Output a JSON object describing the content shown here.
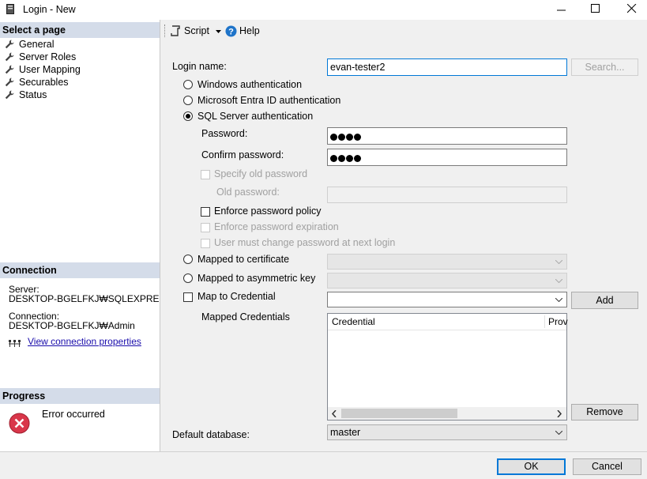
{
  "window": {
    "title": "Login - New",
    "app_icon": "server-icon"
  },
  "left": {
    "select_page_header": "Select a page",
    "pages": [
      {
        "label": "General",
        "icon": "wrench-icon"
      },
      {
        "label": "Server Roles",
        "icon": "wrench-icon"
      },
      {
        "label": "User Mapping",
        "icon": "wrench-icon"
      },
      {
        "label": "Securables",
        "icon": "wrench-icon"
      },
      {
        "label": "Status",
        "icon": "wrench-icon"
      }
    ],
    "connection_header": "Connection",
    "server_label": "Server:",
    "server_value": "DESKTOP-BGELFKJ₩SQLEXPRE",
    "connection_label": "Connection:",
    "connection_value": "DESKTOP-BGELFKJ₩Admin",
    "view_connection_properties": "View connection properties",
    "progress_header": "Progress",
    "progress_status": "Error occurred"
  },
  "toolbar": {
    "script_label": "Script",
    "help_label": "Help"
  },
  "form": {
    "login_name_label": "Login name:",
    "login_name_value": "evan-tester2",
    "search_button": "Search...",
    "auth_windows": "Windows authentication",
    "auth_entra": "Microsoft Entra ID authentication",
    "auth_sql": "SQL Server authentication",
    "password_label": "Password:",
    "confirm_password_label": "Confirm password:",
    "specify_old_password": "Specify old password",
    "old_password_label": "Old password:",
    "enforce_policy": "Enforce password policy",
    "enforce_expiration": "Enforce password expiration",
    "must_change": "User must change password at next login",
    "mapped_certificate": "Mapped to certificate",
    "mapped_asym_key": "Mapped to asymmetric key",
    "map_credential": "Map to Credential",
    "add_button": "Add",
    "mapped_credentials_label": "Mapped Credentials",
    "credentials_columns": [
      "Credential",
      "Prov"
    ],
    "remove_button": "Remove",
    "default_database_label": "Default database:",
    "default_database_value": "master"
  },
  "footer": {
    "ok_button": "OK",
    "cancel_button": "Cancel"
  }
}
